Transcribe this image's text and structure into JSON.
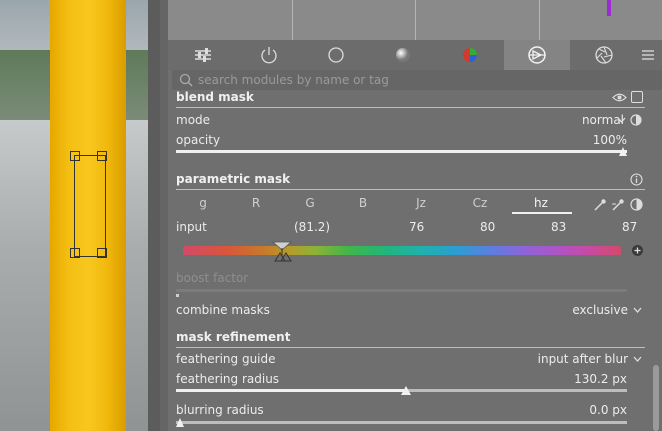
{
  "search": {
    "placeholder": "search modules by name or tag"
  },
  "blend_mask": {
    "title": "blend mask",
    "mode_label": "mode",
    "mode_value": "normal",
    "opacity_label": "opacity",
    "opacity_value": "100%",
    "opacity_fraction": 1.0
  },
  "parametric_mask": {
    "title": "parametric mask",
    "channels": [
      "g",
      "R",
      "G",
      "B",
      "Jz",
      "Cz",
      "hz"
    ],
    "active_channel": "hz",
    "input_label": "input",
    "input_values": [
      "(81.2)",
      "76",
      "80",
      "83",
      "87"
    ],
    "boost_label": "boost factor"
  },
  "combine": {
    "label": "combine masks",
    "value": "exclusive"
  },
  "refinement": {
    "title": "mask refinement",
    "guide_label": "feathering guide",
    "guide_value": "input after blur",
    "radius_label": "feathering radius",
    "radius_value": "130.2 px",
    "radius_fraction": 0.51,
    "blur_label": "blurring radius",
    "blur_value": "0.0 px",
    "blur_fraction": 0.0
  },
  "colors": {
    "accent": "#9c2bd6",
    "panel": "#6f6f6f"
  }
}
